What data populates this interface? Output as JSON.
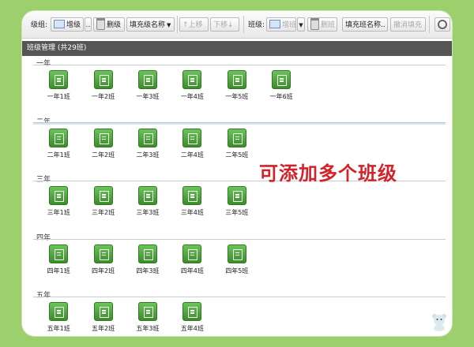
{
  "toolbar": {
    "grade_label": "级组:",
    "grade_add": "增级",
    "grade_more": "..",
    "grade_delete": "删级",
    "grade_fill": "填充级名称",
    "move_up": "↑上移",
    "move_down": "下移↓",
    "class_label": "班级:",
    "class_add": "增班",
    "class_delete": "删班",
    "class_fill": "填充班名称..",
    "cancel_fill": "撤消填充"
  },
  "header": {
    "title": "班级管理 (共29班)"
  },
  "grades": [
    {
      "title": "一年",
      "classes": [
        "一年1班",
        "一年2班",
        "一年3班",
        "一年4班",
        "一年5班",
        "一年6班"
      ]
    },
    {
      "title": "二年",
      "classes": [
        "二年1班",
        "二年2班",
        "二年3班",
        "二年4班",
        "二年5班"
      ]
    },
    {
      "title": "三年",
      "classes": [
        "三年1班",
        "三年2班",
        "三年3班",
        "三年4班",
        "三年5班"
      ]
    },
    {
      "title": "四年",
      "classes": [
        "四年1班",
        "四年2班",
        "四年3班",
        "四年4班",
        "四年5班"
      ]
    },
    {
      "title": "五年",
      "classes": [
        "五年1班",
        "五年2班",
        "五年3班",
        "五年4班"
      ]
    }
  ],
  "annotation": "可添加多个班级",
  "colors": {
    "background": "#9bd06d",
    "icon_green": "#4aa83a",
    "annotation_red": "#d2222a",
    "header_bg": "#555555"
  }
}
